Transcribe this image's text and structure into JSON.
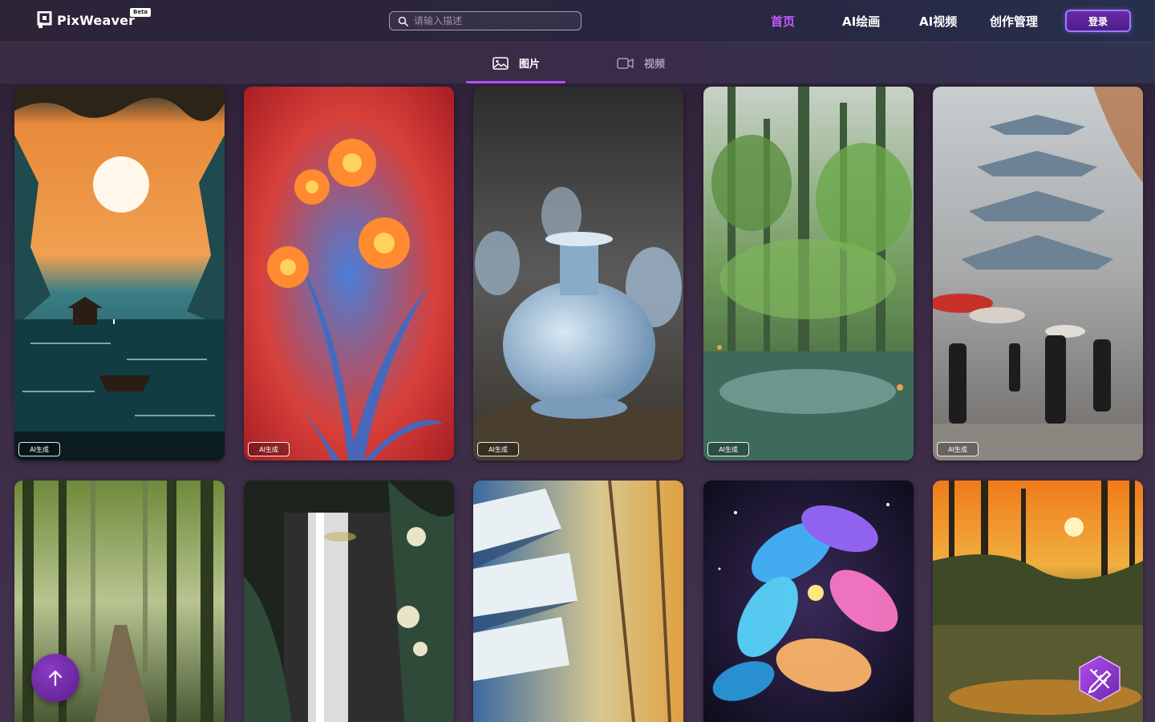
{
  "app": {
    "name": "PixWeaver",
    "badge": "Beta"
  },
  "search": {
    "placeholder": "请输入描述",
    "value": ""
  },
  "nav": {
    "items": [
      {
        "label": "首页",
        "active": true
      },
      {
        "label": "AI绘画",
        "active": false
      },
      {
        "label": "AI视频",
        "active": false
      },
      {
        "label": "创作管理",
        "active": false
      }
    ],
    "login_label": "登录"
  },
  "tabs": [
    {
      "label": "图片",
      "icon": "image-icon",
      "active": true
    },
    {
      "label": "视频",
      "icon": "video-camera-icon",
      "active": false
    }
  ],
  "gallery": {
    "items": [
      {
        "badge": "AI生成",
        "subject": "sunset-lake-pavilion-boat"
      },
      {
        "badge": "AI生成",
        "subject": "orange-lilies-blue-leaves-red-background"
      },
      {
        "badge": "AI生成",
        "subject": "light-blue-ceramic-vase"
      },
      {
        "badge": "AI生成",
        "subject": "green-forest-pond"
      },
      {
        "badge": "AI生成",
        "subject": "rainy-street-pagoda-umbrellas"
      },
      {
        "badge": "",
        "subject": "misty-forest-path"
      },
      {
        "badge": "",
        "subject": "monochrome-waterfall-flowers"
      },
      {
        "badge": "",
        "subject": "snowy-mosaic-trees"
      },
      {
        "badge": "",
        "subject": "neon-glowing-flower-night"
      },
      {
        "badge": "",
        "subject": "sunset-forest-pond"
      }
    ]
  },
  "colors": {
    "accent": "#c658ff",
    "tab_underline": "#b84dff",
    "login_border": "#9c7bff"
  },
  "fabs": {
    "back_to_top": "arrow-up-icon",
    "tool": "pencil-ruler-icon"
  }
}
